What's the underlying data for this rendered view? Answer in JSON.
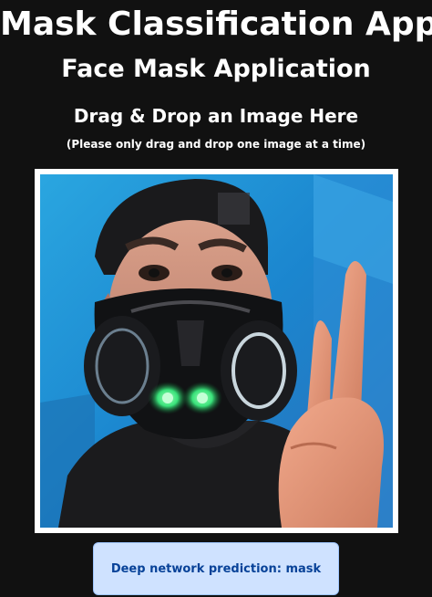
{
  "app": {
    "title": "Mask Classification App",
    "subtitle": "Face Mask Application"
  },
  "upload": {
    "heading": "Drag & Drop an Image Here",
    "note": "(Please only drag and drop one image at a time)",
    "image_subject": "man-wearing-respirator-mask-peace-sign"
  },
  "result": {
    "text": "Deep network prediction: mask"
  },
  "colors": {
    "background": "#111111",
    "text": "#ffffff",
    "drop_border": "#ffffff",
    "alert_bg": "#cfe2ff",
    "alert_border": "#9ec5fe",
    "alert_text": "#084298",
    "mask_glow": "#39e27a"
  }
}
